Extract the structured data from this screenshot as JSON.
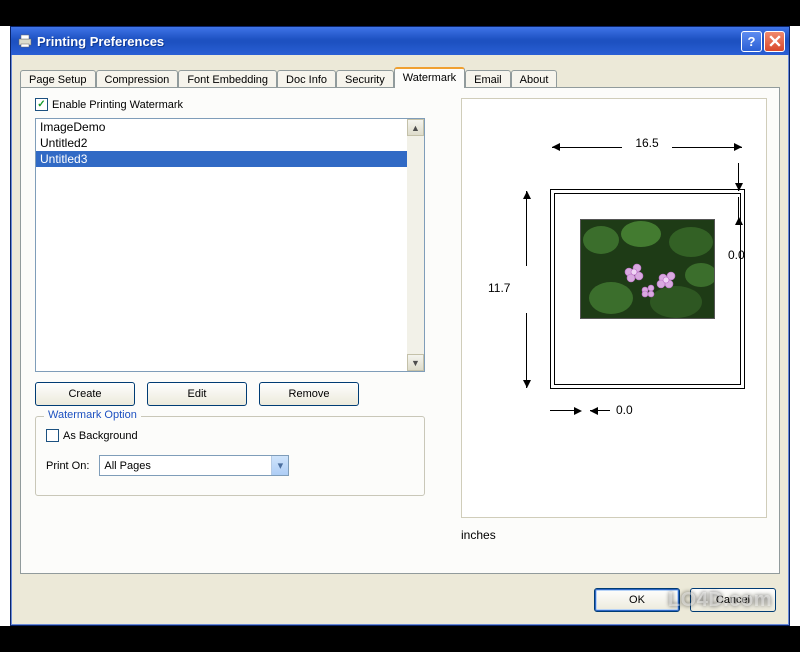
{
  "window": {
    "title": "Printing Preferences"
  },
  "tabs": {
    "items": [
      {
        "label": "Page Setup"
      },
      {
        "label": "Compression"
      },
      {
        "label": "Font Embedding"
      },
      {
        "label": "Doc Info"
      },
      {
        "label": "Security"
      },
      {
        "label": "Watermark"
      },
      {
        "label": "Email"
      },
      {
        "label": "About"
      }
    ],
    "active_index": 5
  },
  "watermark": {
    "enable_label": "Enable Printing Watermark",
    "enable_checked": true,
    "list": [
      "ImageDemo",
      "Untitled2",
      "Untitled3"
    ],
    "selected_index": 2,
    "buttons": {
      "create": "Create",
      "edit": "Edit",
      "remove": "Remove"
    },
    "option": {
      "legend": "Watermark Option",
      "as_background_label": "As Background",
      "as_background_checked": false,
      "print_on_label": "Print On:",
      "print_on_value": "All Pages"
    }
  },
  "preview": {
    "width": "16.5",
    "height": "11.7",
    "offset_x": "0.0",
    "offset_y": "0.0",
    "units": "inches"
  },
  "dialog": {
    "ok": "OK",
    "cancel": "Cancel"
  },
  "overlay_watermark": "LO4D.com"
}
